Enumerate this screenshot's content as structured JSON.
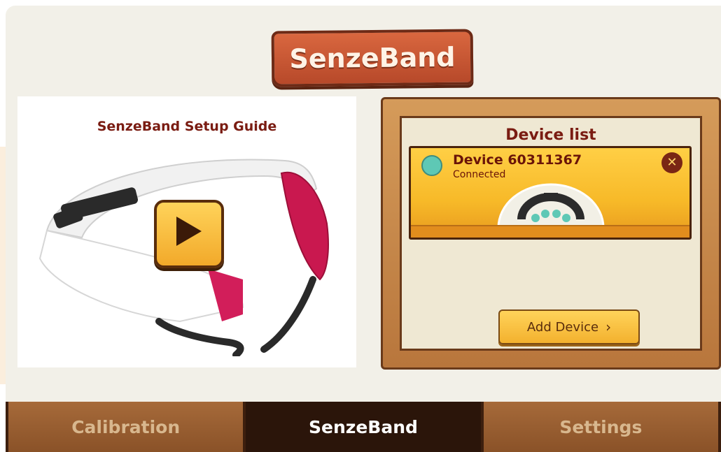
{
  "title": "SenzeBand",
  "guide": {
    "title": "SenzeBand Setup Guide"
  },
  "device_panel": {
    "title": "Device list",
    "devices": [
      {
        "name": "Device 60311367",
        "status": "Connected",
        "status_color": "#5ec8b5"
      }
    ],
    "add_label": "Add Device"
  },
  "tabs": [
    {
      "label": "Calibration",
      "active": false
    },
    {
      "label": "SenzeBand",
      "active": true
    },
    {
      "label": "Settings",
      "active": false
    }
  ],
  "icons": {
    "play": "play-icon",
    "remove": "close-icon",
    "chevron": "chevron-right-icon"
  },
  "colors": {
    "accent_red": "#7a1c12",
    "wood": "#a66a3a",
    "yellow": "#f7b928",
    "teal": "#5ec8b5"
  }
}
